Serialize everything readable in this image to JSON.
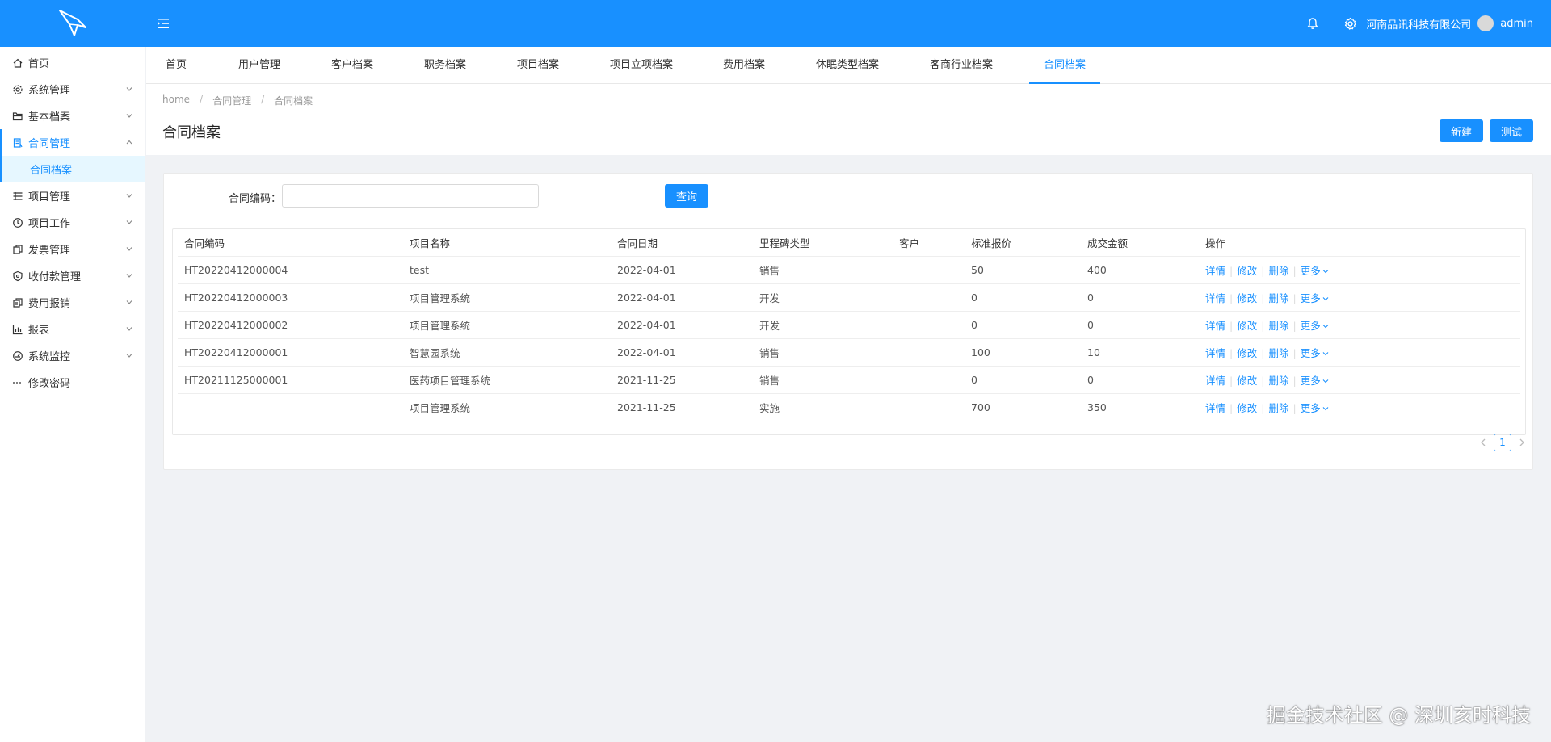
{
  "header": {
    "company": "河南品讯科技有限公司",
    "username": "admin"
  },
  "sidebar": {
    "items": [
      {
        "label": "首页",
        "icon": "home-icon"
      },
      {
        "label": "系统管理",
        "icon": "gear-icon"
      },
      {
        "label": "基本档案",
        "icon": "folder-open-icon"
      },
      {
        "label": "合同管理",
        "icon": "contract-icon"
      },
      {
        "label": "项目管理",
        "icon": "list-icon"
      },
      {
        "label": "项目工作",
        "icon": "clock-icon"
      },
      {
        "label": "发票管理",
        "icon": "invoice-icon"
      },
      {
        "label": "收付款管理",
        "icon": "shield-icon"
      },
      {
        "label": "费用报销",
        "icon": "receipt-icon"
      },
      {
        "label": "报表",
        "icon": "bar-chart-icon"
      },
      {
        "label": "系统监控",
        "icon": "dashboard-icon"
      },
      {
        "label": "修改密码",
        "icon": "dots-icon"
      }
    ],
    "sub_item": "合同档案"
  },
  "tabs": [
    "首页",
    "用户管理",
    "客户档案",
    "职务档案",
    "项目档案",
    "项目立项档案",
    "费用档案",
    "休眠类型档案",
    "客商行业档案",
    "合同档案"
  ],
  "breadcrumb": [
    "home",
    "合同管理",
    "合同档案"
  ],
  "page_title": "合同档案",
  "buttons": {
    "new": "新建",
    "test": "测试",
    "query": "查询"
  },
  "search": {
    "label": "合同编码：",
    "value": ""
  },
  "table": {
    "headers": [
      "合同编码",
      "项目名称",
      "合同日期",
      "里程碑类型",
      "客户",
      "标准报价",
      "成交金额",
      "操作"
    ],
    "rows": [
      {
        "code": "HT20220412000004",
        "name": "test",
        "date": "2022-04-01",
        "type": "销售",
        "customer": "",
        "price": "50",
        "amount": "400"
      },
      {
        "code": "HT20220412000003",
        "name": "项目管理系统",
        "date": "2022-04-01",
        "type": "开发",
        "customer": "",
        "price": "0",
        "amount": "0"
      },
      {
        "code": "HT20220412000002",
        "name": "项目管理系统",
        "date": "2022-04-01",
        "type": "开发",
        "customer": "",
        "price": "0",
        "amount": "0"
      },
      {
        "code": "HT20220412000001",
        "name": "智慧园系统",
        "date": "2022-04-01",
        "type": "销售",
        "customer": "",
        "price": "100",
        "amount": "10"
      },
      {
        "code": "HT20211125000001",
        "name": "医药项目管理系统",
        "date": "2021-11-25",
        "type": "销售",
        "customer": "",
        "price": "0",
        "amount": "0"
      },
      {
        "code": "",
        "name": "项目管理系统",
        "date": "2021-11-25",
        "type": "实施",
        "customer": "",
        "price": "700",
        "amount": "350"
      }
    ],
    "ops": {
      "detail": "详情",
      "edit": "修改",
      "delete": "删除",
      "more": "更多"
    }
  },
  "pagination": {
    "current": "1"
  },
  "watermark": "掘金技术社区 @ 深圳亥时科技",
  "colors": {
    "primary": "#1890ff",
    "background": "#f0f2f5"
  }
}
